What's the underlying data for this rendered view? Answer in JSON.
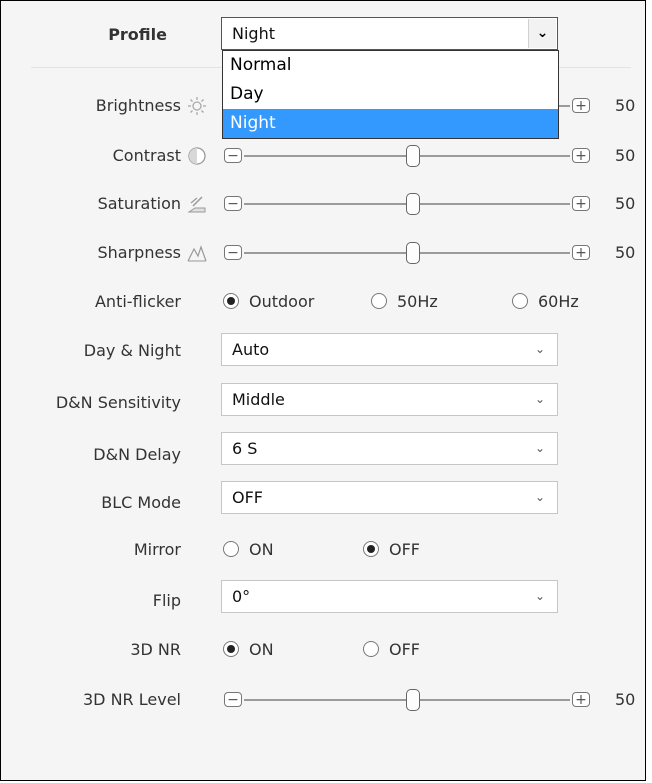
{
  "profile": {
    "label": "Profile",
    "value": "Night",
    "options": [
      "Normal",
      "Day",
      "Night"
    ],
    "selected": "Night"
  },
  "brightness": {
    "label": "Brightness",
    "value": "50",
    "level": 50,
    "icon": "sun-icon"
  },
  "contrast": {
    "label": "Contrast",
    "value": "50",
    "level": 50,
    "icon": "contrast-icon"
  },
  "saturation": {
    "label": "Saturation",
    "value": "50",
    "level": 50,
    "icon": "saturation-icon"
  },
  "sharpness": {
    "label": "Sharpness",
    "value": "50",
    "level": 50,
    "icon": "sharpness-icon"
  },
  "antiflicker": {
    "label": "Anti-flicker",
    "options": [
      "Outdoor",
      "50Hz",
      "60Hz"
    ],
    "selected": "Outdoor"
  },
  "day_night": {
    "label": "Day & Night",
    "value": "Auto"
  },
  "dn_sensitivity": {
    "label": "D&N Sensitivity",
    "value": "Middle"
  },
  "dn_delay": {
    "label": "D&N Delay",
    "value": "6 S"
  },
  "blc_mode": {
    "label": "BLC Mode",
    "value": "OFF"
  },
  "mirror": {
    "label": "Mirror",
    "options": [
      "ON",
      "OFF"
    ],
    "selected": "OFF"
  },
  "flip": {
    "label": "Flip",
    "value": "0°"
  },
  "nr3d": {
    "label": "3D NR",
    "options": [
      "ON",
      "OFF"
    ],
    "selected": "ON"
  },
  "nr3d_level": {
    "label": "3D NR Level",
    "value": "50",
    "level": 50
  },
  "colors": {
    "panel_bg": "#f5f5f5",
    "selected_option": "#3399ff"
  },
  "symbols": {
    "minus": "−",
    "plus": "+",
    "chevron": "⌄"
  }
}
